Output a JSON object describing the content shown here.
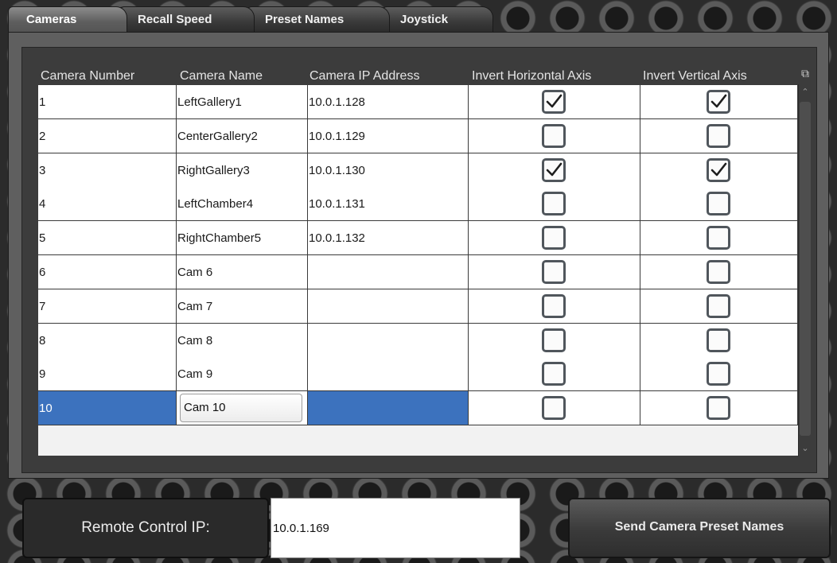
{
  "tabs": [
    {
      "label": "Cameras",
      "active": true
    },
    {
      "label": "Recall Speed",
      "active": false
    },
    {
      "label": "Preset Names",
      "active": false
    },
    {
      "label": "Joystick",
      "active": false
    }
  ],
  "grid": {
    "columns": [
      "Camera Number",
      "Camera Name",
      "Camera IP Address",
      "Invert Horizontal Axis",
      "Invert Vertical Axis"
    ],
    "rows": [
      {
        "number": "1",
        "name": "LeftGallery1",
        "ip": "10.0.1.128",
        "invert_h": true,
        "invert_v": true
      },
      {
        "number": "2",
        "name": "CenterGallery2",
        "ip": "10.0.1.129",
        "invert_h": false,
        "invert_v": false
      },
      {
        "number": "3",
        "name": "RightGallery3",
        "ip": "10.0.1.130",
        "invert_h": true,
        "invert_v": true
      },
      {
        "number": "4",
        "name": "LeftChamber4",
        "ip": "10.0.1.131",
        "invert_h": false,
        "invert_v": false
      },
      {
        "number": "5",
        "name": "RightChamber5",
        "ip": "10.0.1.132",
        "invert_h": false,
        "invert_v": false
      },
      {
        "number": "6",
        "name": "Cam 6",
        "ip": "",
        "invert_h": false,
        "invert_v": false
      },
      {
        "number": "7",
        "name": "Cam 7",
        "ip": "",
        "invert_h": false,
        "invert_v": false
      },
      {
        "number": "8",
        "name": "Cam 8",
        "ip": "",
        "invert_h": false,
        "invert_v": false
      },
      {
        "number": "9",
        "name": "Cam 9",
        "ip": "",
        "invert_h": false,
        "invert_v": false
      },
      {
        "number": "10",
        "name": "Cam 10",
        "ip": "",
        "invert_h": false,
        "invert_v": false,
        "selected": true,
        "editing": true
      }
    ]
  },
  "bottom": {
    "remote_label": "Remote Control IP:",
    "remote_ip": "10.0.1.169",
    "send_button": "Send Camera Preset Names"
  },
  "colors": {
    "selection": "#3c72be",
    "background": "#2b2b2b"
  }
}
